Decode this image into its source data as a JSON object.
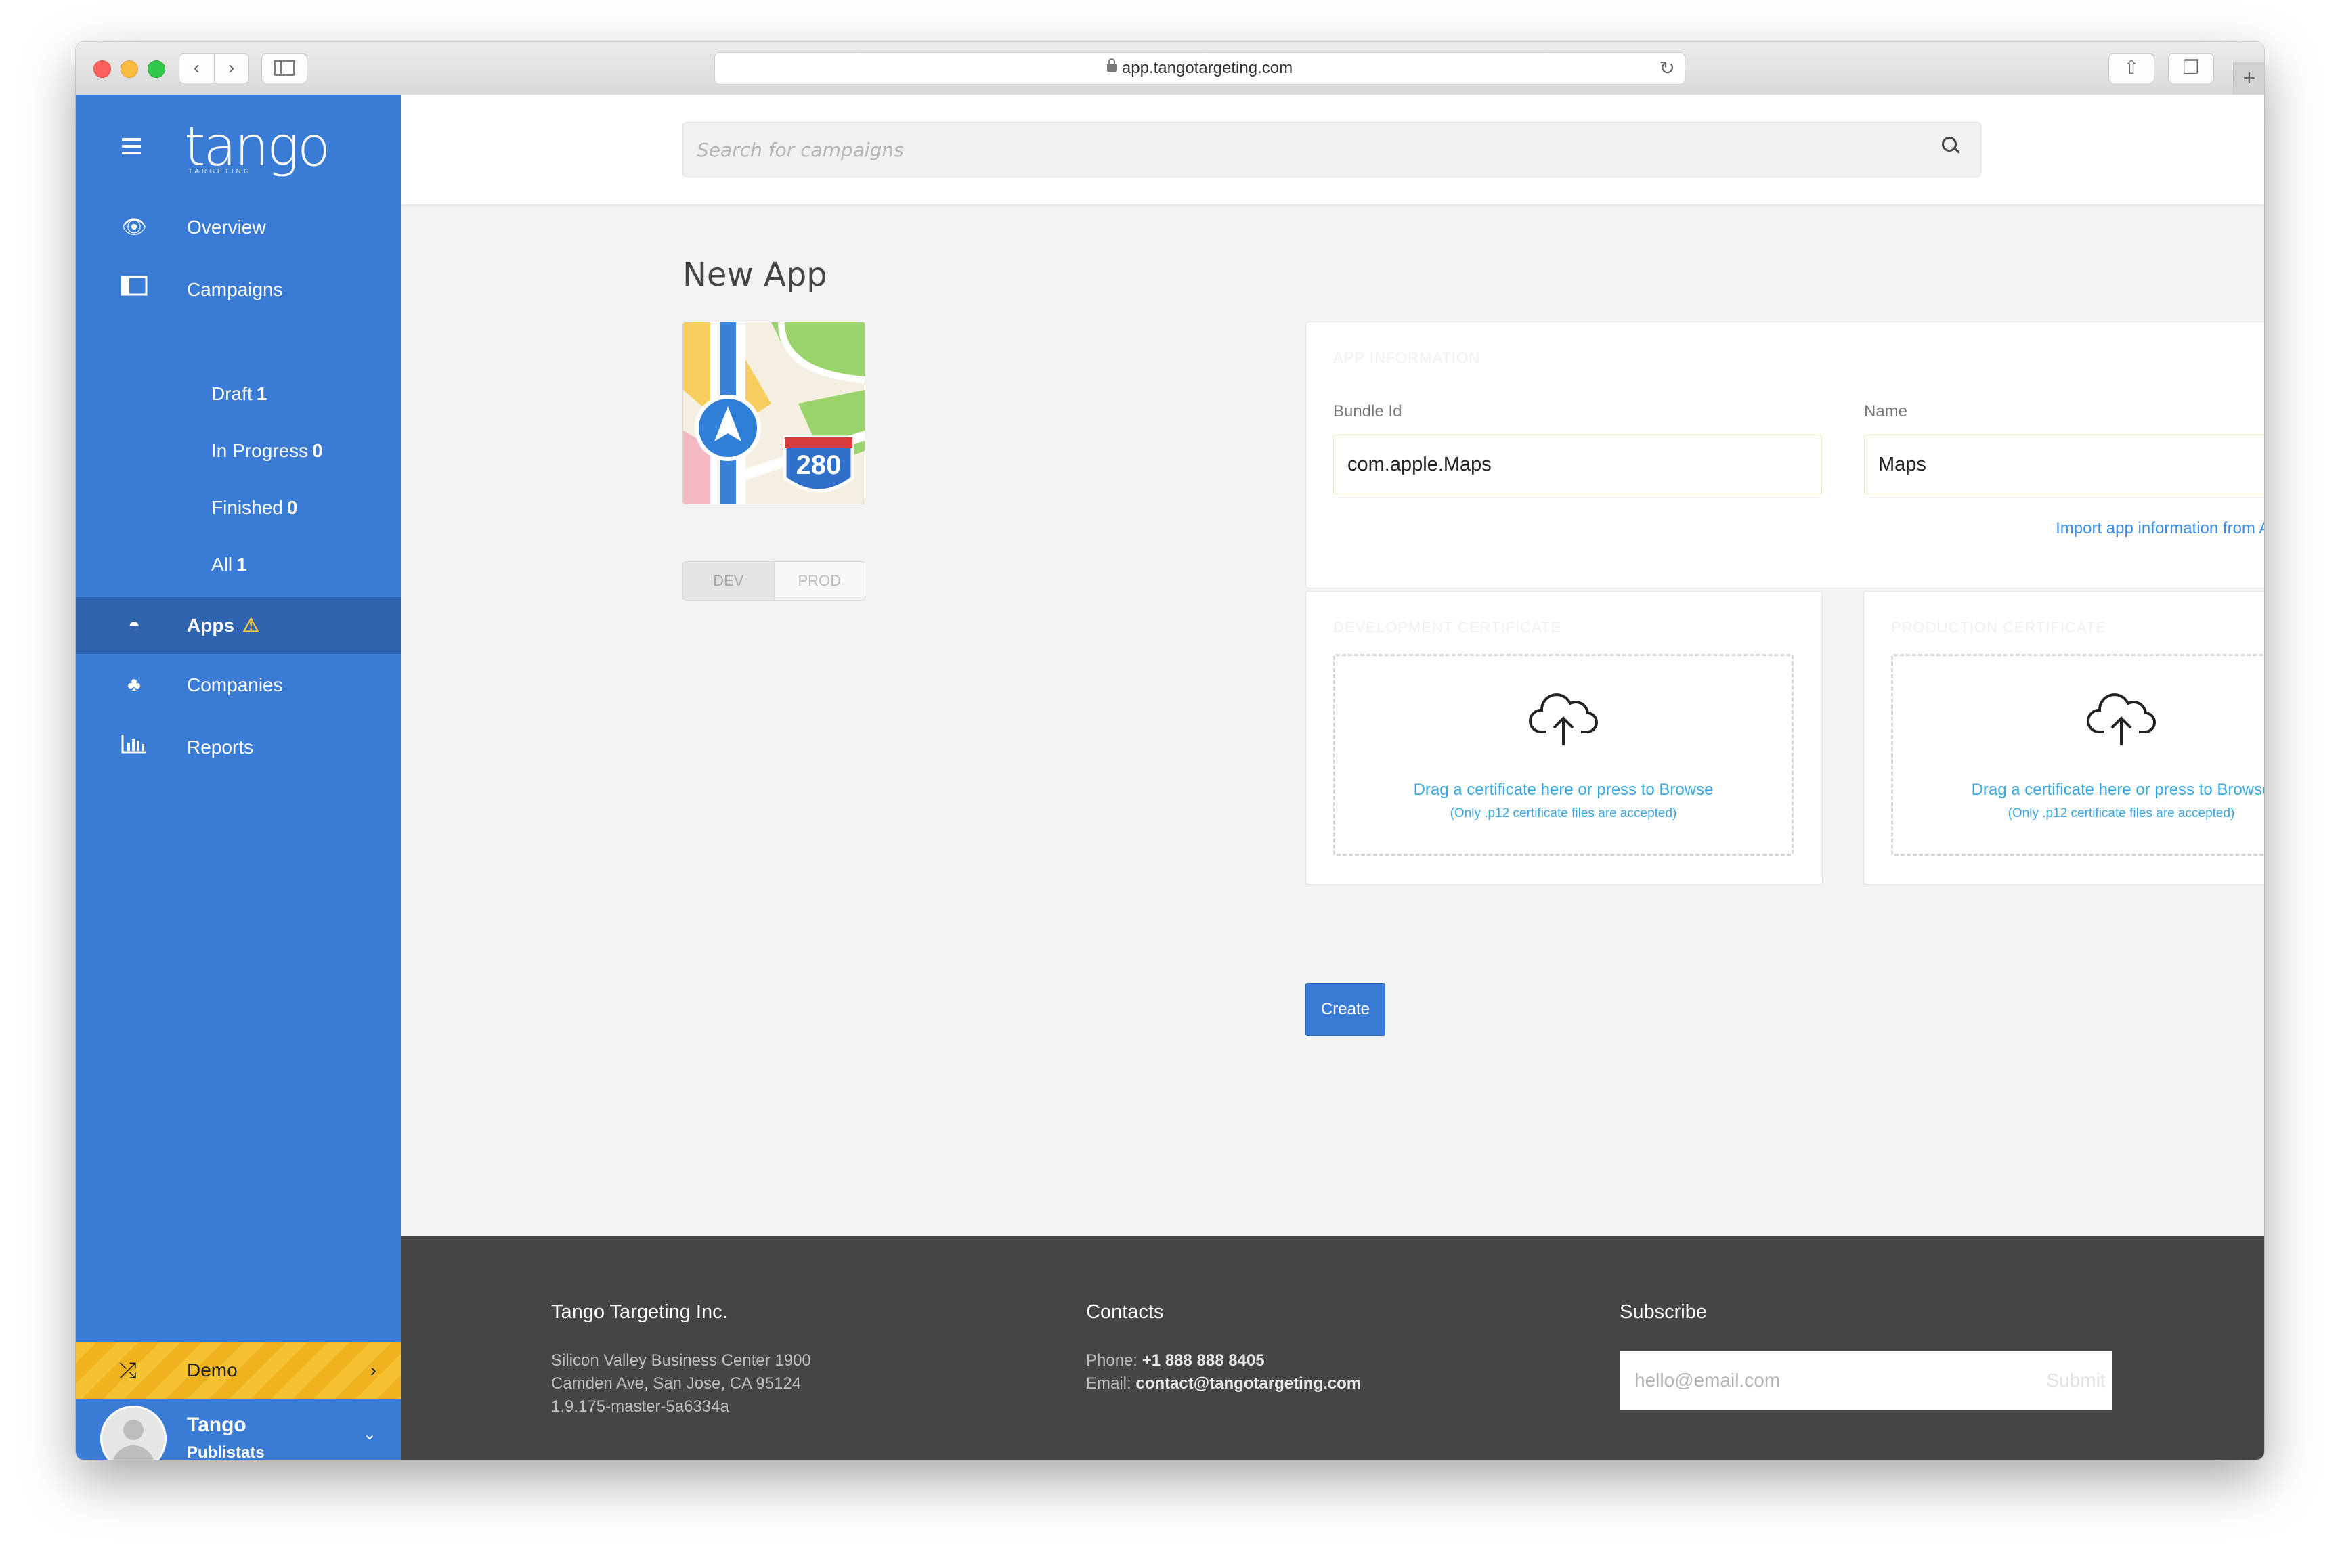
{
  "browser": {
    "url": "app.tangotargeting.com"
  },
  "sidebar": {
    "logo": "tango",
    "logo_sub": "TARGETING",
    "items": [
      {
        "label": "Overview"
      },
      {
        "label": "Campaigns"
      },
      {
        "label": "Apps"
      },
      {
        "label": "Companies"
      },
      {
        "label": "Reports"
      }
    ],
    "campaign_sub": [
      {
        "label": "Draft",
        "count": "1"
      },
      {
        "label": "In Progress",
        "count": "0"
      },
      {
        "label": "Finished",
        "count": "0"
      },
      {
        "label": "All",
        "count": "1"
      }
    ],
    "demo_label": "Demo",
    "user": {
      "name": "Tango",
      "org": "Publistats"
    }
  },
  "search": {
    "placeholder": "Search for campaigns"
  },
  "page": {
    "title": "New App",
    "env_toggle": [
      "DEV",
      "PROD"
    ],
    "app_info": {
      "title": "APP INFORMATION",
      "bundle_label": "Bundle Id",
      "bundle_value": "com.apple.Maps",
      "name_label": "Name",
      "name_value": "Maps",
      "import_link": "Import app information from AppStore ⤴"
    },
    "dev_cert": {
      "title": "DEVELOPMENT CERTIFICATE",
      "drop_text": "Drag a certificate here or press to Browse",
      "note": "(Only .p12 certificate files are accepted)"
    },
    "prod_cert": {
      "title": "PRODUCTION CERTIFICATE",
      "drop_text": "Drag a certificate here or press to Browse",
      "note": "(Only .p12 certificate files are accepted)"
    },
    "create_label": "Create",
    "app_icon_shield": "280"
  },
  "footer": {
    "company": {
      "title": "Tango Targeting Inc.",
      "lines": [
        "Silicon Valley Business Center 1900",
        "Camden Ave, San Jose, CA 95124",
        "1.9.175-master-5a6334a"
      ]
    },
    "contacts": {
      "title": "Contacts",
      "phone_label": "Phone:",
      "phone": "+1 888 888 8405",
      "email_label": "Email:",
      "email": "contact@tangotargeting.com"
    },
    "subscribe": {
      "title": "Subscribe",
      "placeholder": "hello@email.com",
      "button": "Submit"
    }
  },
  "colors": {
    "sidebar": "#3a7bd5",
    "sidebar_active": "#2f63ad",
    "demo_stripe": "#f5c233",
    "footer": "#454545",
    "link": "#3a8ee6"
  }
}
